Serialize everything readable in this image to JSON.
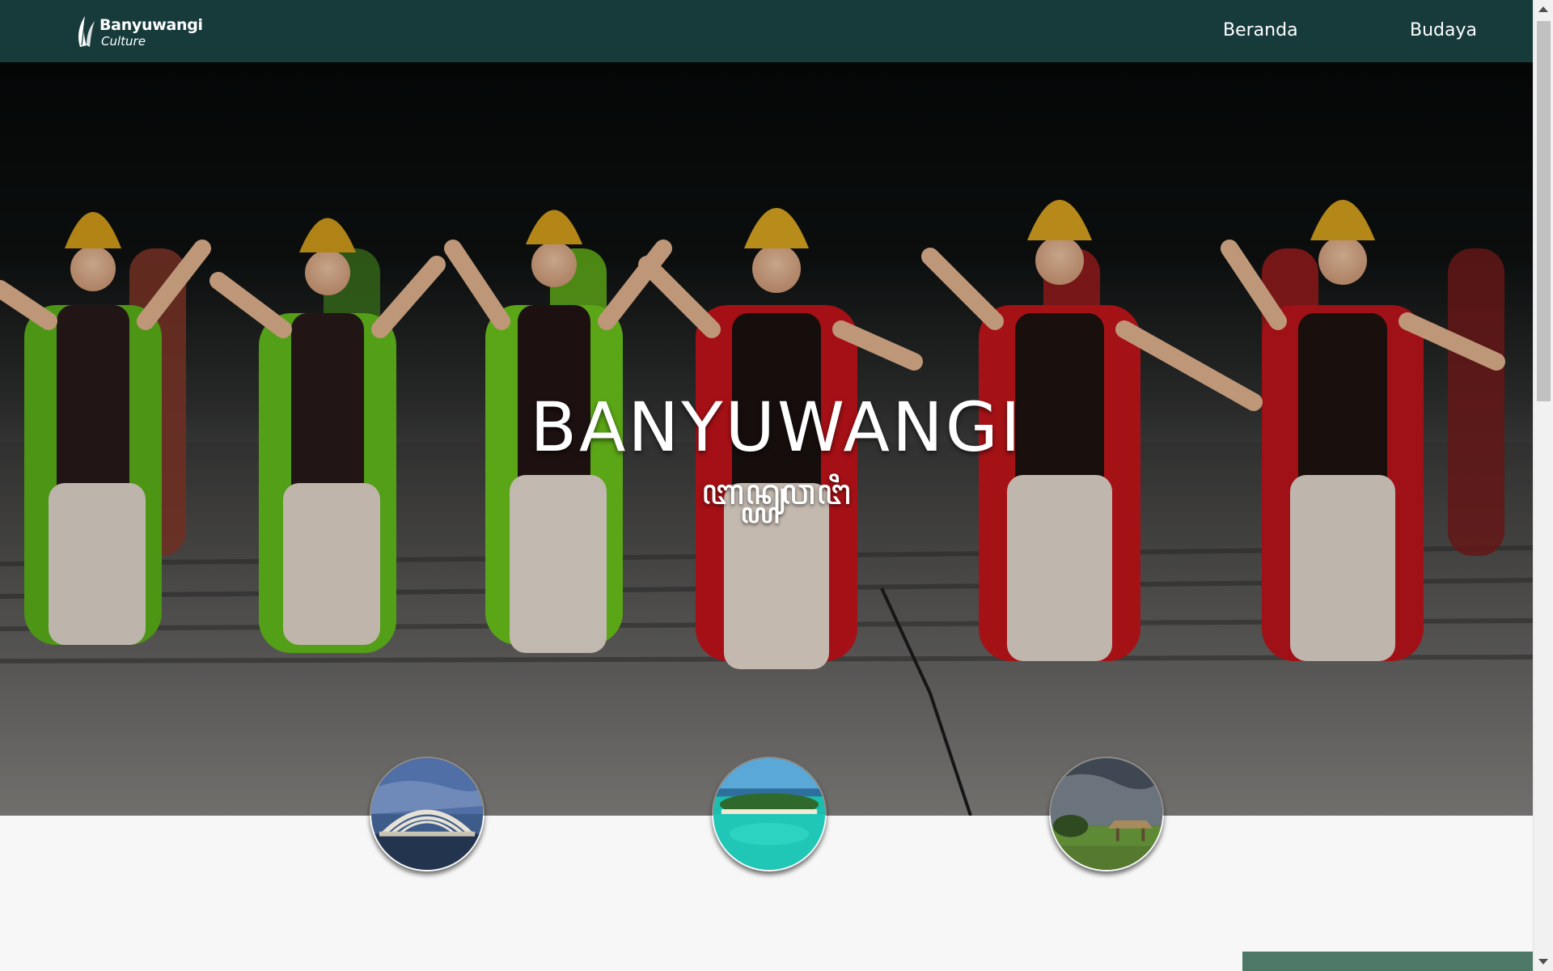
{
  "nav": {
    "logo_title": "Banyuwangi",
    "logo_subtitle": "Culture",
    "links": [
      {
        "label": "Beranda"
      },
      {
        "label": "Budaya"
      }
    ]
  },
  "hero": {
    "title": "BANYUWANGI",
    "script_text": "ꦧꦤ꧀ꦪꦸꦮꦔꦶ",
    "background": "gandrung-dancers-photo"
  },
  "thumbnails": [
    {
      "name": "bridge-photo"
    },
    {
      "name": "island-beach-photo"
    },
    {
      "name": "savanna-hut-photo"
    }
  ],
  "colors": {
    "nav_bg": "#173b3b",
    "accent_tab": "#4d7868",
    "page_bg": "#f7f7f7"
  }
}
